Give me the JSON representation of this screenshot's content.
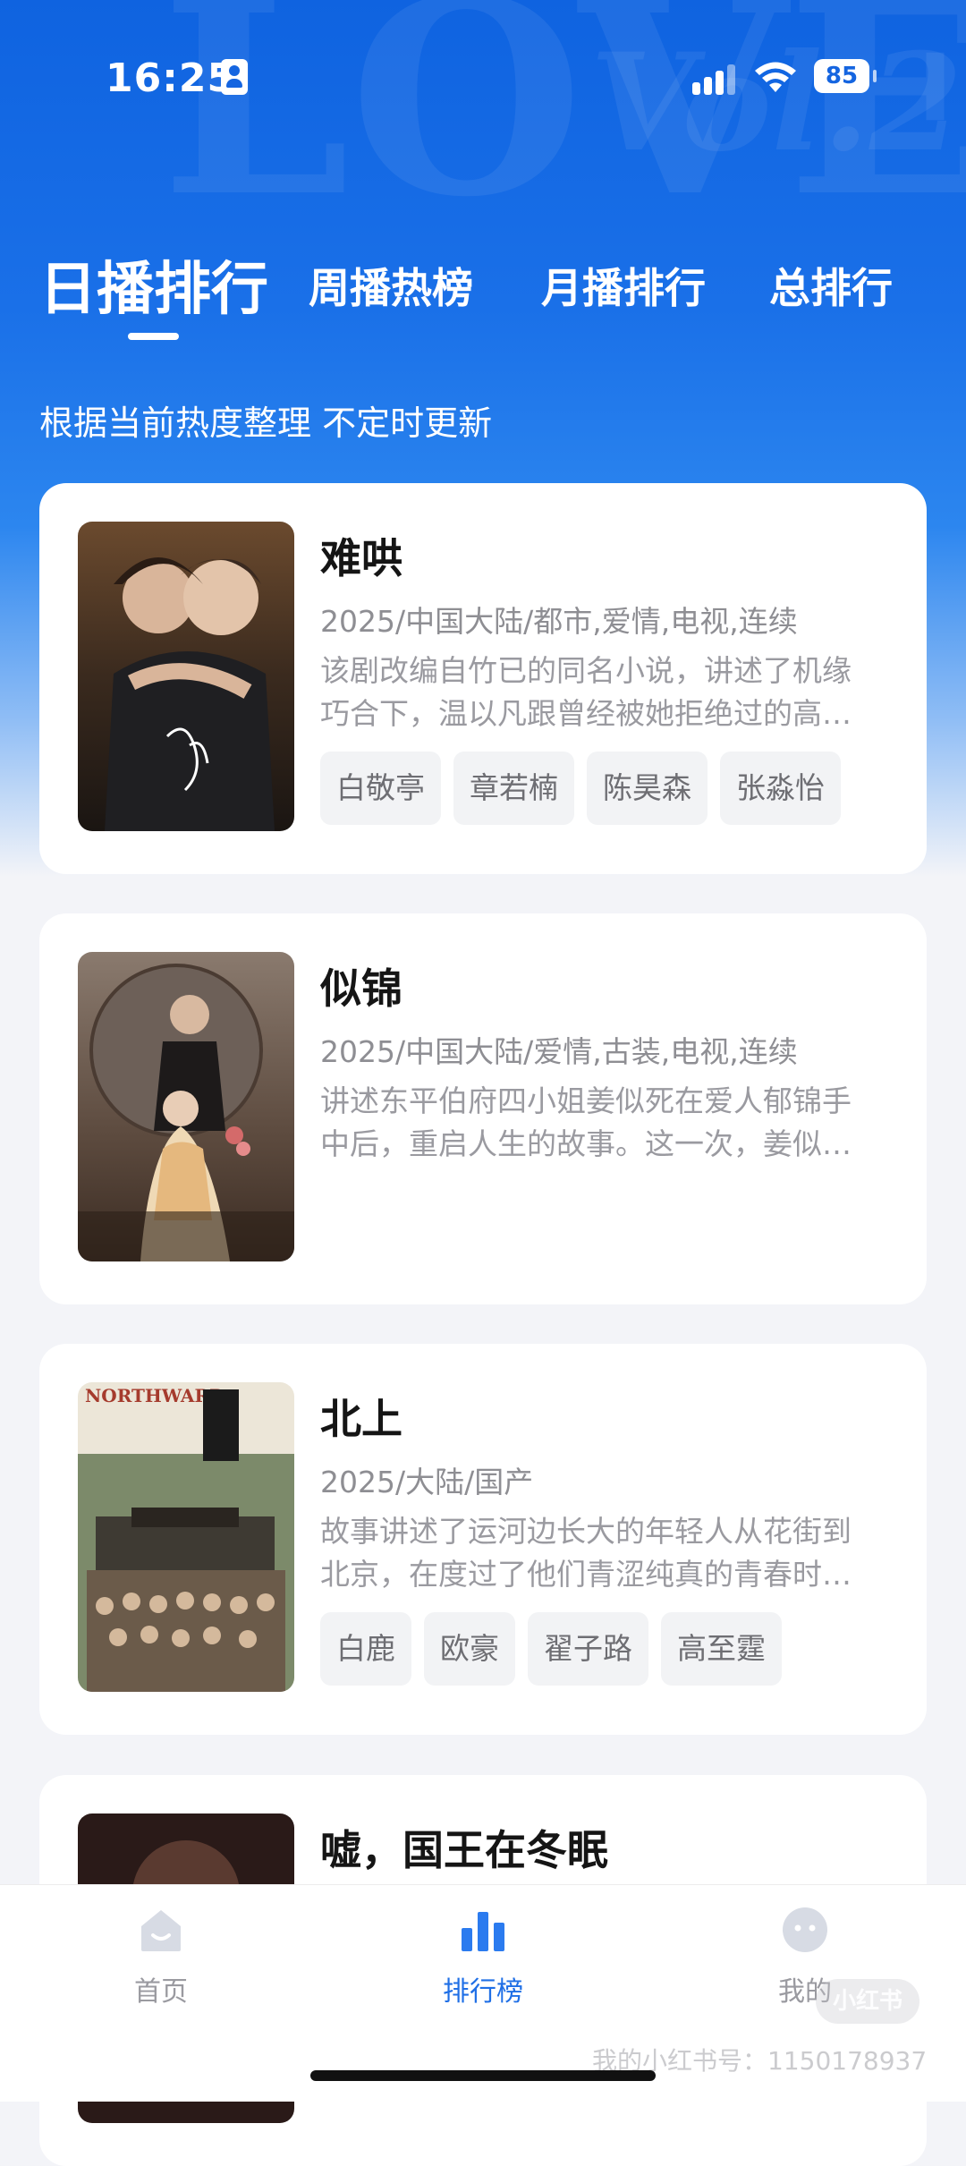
{
  "status_bar": {
    "time": "16:25",
    "battery": "85"
  },
  "header": {
    "tabs": [
      {
        "label": "日播排行"
      },
      {
        "label": "周播热榜"
      },
      {
        "label": "月播排行"
      },
      {
        "label": "总排行"
      }
    ],
    "subtitle": "根据当前热度整理 不定时更新"
  },
  "list": [
    {
      "title": "难哄",
      "meta": "2025/中国大陆/都市,爱情,电视,连续",
      "desc_line1": "该剧改编自竹已的同名小说，讲述了机缘",
      "desc_line2": "巧合下，温以凡跟曾经被她拒绝过的高…",
      "tags": [
        "白敬亭",
        "章若楠",
        "陈昊森",
        "张淼怡"
      ]
    },
    {
      "title": "似锦",
      "meta": "2025/中国大陆/爱情,古装,电视,连续",
      "desc_line1": "讲述东平伯府四小姐姜似死在爱人郁锦手",
      "desc_line2": "中后，重启人生的故事。这一次，姜似…",
      "tags": []
    },
    {
      "title": "北上",
      "meta": "2025/大陆/国产",
      "desc_line1": "故事讲述了运河边长大的年轻人从花街到",
      "desc_line2": "北京，在度过了他们青涩纯真的青春时…",
      "tags": [
        "白鹿",
        "欧豪",
        "翟子路",
        "高至霆"
      ],
      "poster_text": "NORTHWARD"
    },
    {
      "title": "嘘，国王在冬眠"
    }
  ],
  "bottom_nav": [
    {
      "label": "首页",
      "icon": "home-icon"
    },
    {
      "label": "排行榜",
      "icon": "ranking-icon",
      "active": true
    },
    {
      "label": "我的",
      "icon": "profile-icon"
    }
  ],
  "watermark": "我的小红书号：1150178937"
}
